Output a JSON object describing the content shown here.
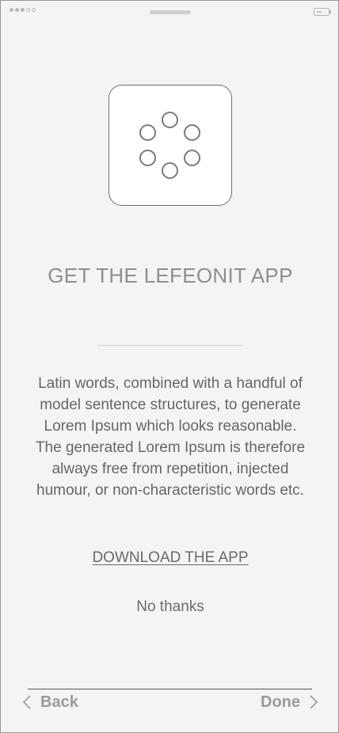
{
  "status_bar": {
    "signal_bars_filled": 3,
    "signal_bars_total": 5,
    "icons": [
      "signal-dots-icon",
      "battery-icon"
    ]
  },
  "app_icon": {
    "icon": "loader-circles-icon"
  },
  "title": "GET THE LEFEONIT APP",
  "description_lines": [
    "Latin words, combined with a handful of",
    "model sentence structures, to generate",
    "Lorem Ipsum which looks reasonable.",
    "The generated Lorem Ipsum is therefore",
    "always free from repetition, injected",
    "humour, or non-characteristic words etc."
  ],
  "download_link": "DOWNLOAD THE APP",
  "no_thanks": "No thanks",
  "footer": {
    "back_label": "Back",
    "done_label": "Done",
    "back_icon": "chevron-left-icon",
    "done_icon": "chevron-right-icon"
  },
  "colors": {
    "background": "#f4f4f4",
    "title": "#8e8e8e",
    "body_text": "#666666",
    "nav_text": "#9a9a9a"
  }
}
